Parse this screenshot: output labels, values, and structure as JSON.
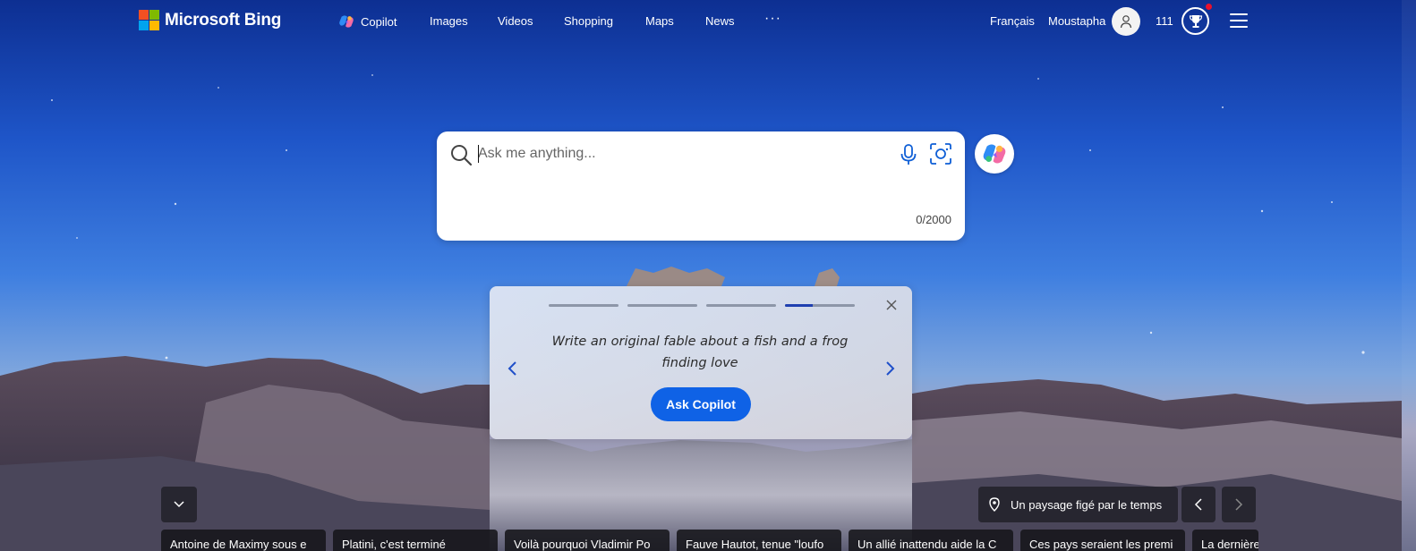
{
  "brand": {
    "name": "Microsoft Bing",
    "logo_colors": [
      "#f25022",
      "#7fba00",
      "#00a4ef",
      "#ffb900"
    ]
  },
  "nav": {
    "items": [
      {
        "label": "Copilot",
        "icon": "copilot-icon"
      },
      {
        "label": "Images"
      },
      {
        "label": "Videos"
      },
      {
        "label": "Shopping"
      },
      {
        "label": "Maps"
      },
      {
        "label": "News"
      }
    ],
    "more": "···"
  },
  "account": {
    "language": "Français",
    "username": "Moustapha",
    "avatar_icon": "user-icon",
    "points": "111",
    "rewards_icon": "trophy-icon",
    "menu_icon": "hamburger-menu-icon"
  },
  "search": {
    "placeholder": "Ask me anything...",
    "value": "",
    "char_count": "0/2000",
    "icons": [
      "search-icon",
      "microphone-icon",
      "visual-search-icon"
    ],
    "copilot_button_icon": "copilot-icon"
  },
  "suggestion_card": {
    "progress_segments": 4,
    "active_segment": 4,
    "active_progress": 0.4,
    "text": "Write an original fable about a fish and a frog finding love",
    "button_label": "Ask Copilot",
    "accent": "#0f62e6"
  },
  "background": {
    "caption": "Un paysage figé par le temps",
    "caption_icon": "location-pin-icon"
  },
  "news": [
    "Antoine de Maximy sous e",
    "Platini, c'est terminé",
    "Voilà pourquoi Vladimir Po",
    "Fauve Hautot, tenue \"loufo",
    "Un allié inattendu aide la C",
    "Ces pays seraient les premi",
    "La dernière"
  ]
}
